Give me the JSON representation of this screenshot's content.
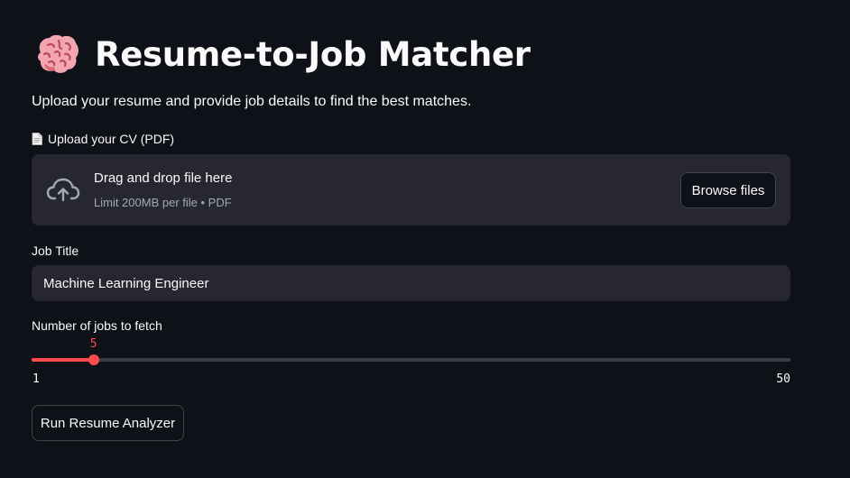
{
  "header": {
    "title": "Resume-to-Job Matcher",
    "icon": "brain-icon"
  },
  "subtitle": "Upload your resume and provide job details to find the best matches.",
  "uploader": {
    "label": "Upload your CV (PDF)",
    "label_icon": "document-icon",
    "dropzone_title": "Drag and drop file here",
    "dropzone_limit": "Limit 200MB per file • PDF",
    "upload_icon": "cloud-upload-icon",
    "browse_label": "Browse files"
  },
  "job_title": {
    "label": "Job Title",
    "value": "Machine Learning Engineer"
  },
  "slider": {
    "label": "Number of jobs to fetch",
    "value": 5,
    "min": 1,
    "max": 50
  },
  "run_button": {
    "label": "Run Resume Analyzer"
  },
  "colors": {
    "background": "#0e1117",
    "surface": "#262730",
    "accent": "#ff4b4b",
    "text": "#fafafa",
    "muted_text": "#a3a8b8"
  }
}
